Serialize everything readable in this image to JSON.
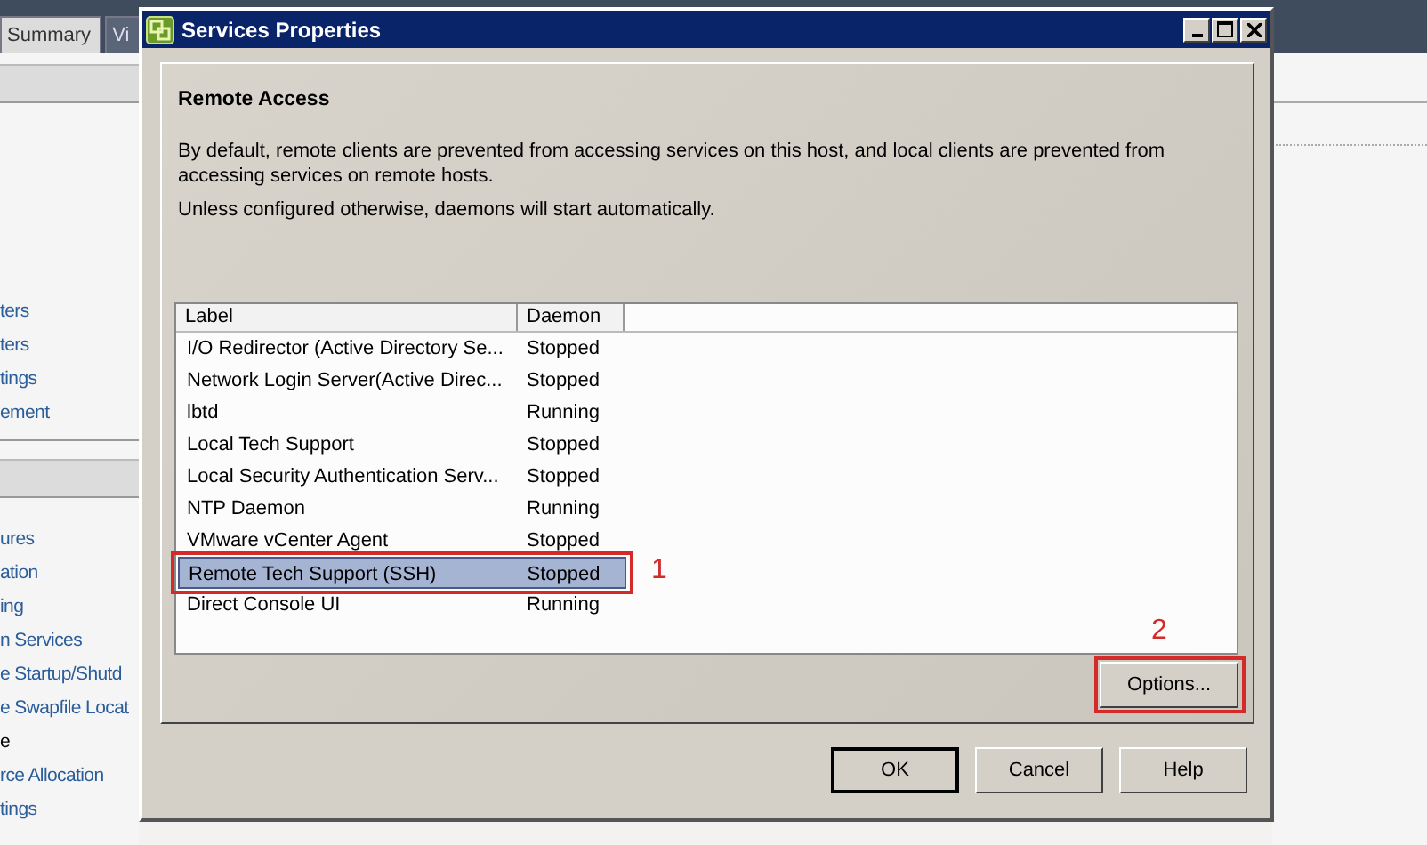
{
  "background_window": {
    "tabs": [
      {
        "label": "Summary",
        "selected": true
      },
      {
        "label": "Vi",
        "selected": false
      }
    ],
    "sidebar": {
      "groups": [
        {
          "items": [
            {
              "label": "ters",
              "selected": false
            },
            {
              "label": "ters",
              "selected": false
            },
            {
              "label": "tings",
              "selected": false
            },
            {
              "label": "ement",
              "selected": false
            }
          ]
        },
        {
          "items": [
            {
              "label": "ures",
              "selected": false
            },
            {
              "label": "ation",
              "selected": false
            },
            {
              "label": "ing",
              "selected": false
            },
            {
              "label": "n Services",
              "selected": false
            },
            {
              "label": "e Startup/Shutd",
              "selected": false
            },
            {
              "label": "e Swapfile Locat",
              "selected": false
            },
            {
              "label": "e",
              "selected": true
            },
            {
              "label": "rce Allocation",
              "selected": false
            },
            {
              "label": "tings",
              "selected": false
            }
          ]
        }
      ]
    }
  },
  "dialog": {
    "title": "Services Properties",
    "section": {
      "heading": "Remote Access",
      "paragraphs": [
        "By default, remote clients are prevented from accessing services on this host, and local clients are prevented from accessing services on remote hosts.",
        "Unless configured otherwise, daemons will start automatically."
      ]
    },
    "table": {
      "columns": [
        "Label",
        "Daemon"
      ],
      "rows": [
        {
          "label": "I/O Redirector (Active Directory Se...",
          "daemon": "Stopped",
          "selected": false
        },
        {
          "label": "Network Login Server(Active Direc...",
          "daemon": "Stopped",
          "selected": false
        },
        {
          "label": "lbtd",
          "daemon": "Running",
          "selected": false
        },
        {
          "label": "Local Tech Support",
          "daemon": "Stopped",
          "selected": false
        },
        {
          "label": "Local Security Authentication Serv...",
          "daemon": "Stopped",
          "selected": false
        },
        {
          "label": "NTP Daemon",
          "daemon": "Running",
          "selected": false
        },
        {
          "label": "VMware vCenter Agent",
          "daemon": "Stopped",
          "selected": false
        },
        {
          "label": "Remote Tech Support (SSH)",
          "daemon": "Stopped",
          "selected": true,
          "callout": "1"
        },
        {
          "label": "Direct Console UI",
          "daemon": "Running",
          "selected": false
        }
      ]
    },
    "options_button": {
      "label": "Options...",
      "callout": "2"
    },
    "buttons": [
      {
        "label": "OK",
        "default": true
      },
      {
        "label": "Cancel",
        "default": false
      },
      {
        "label": "Help",
        "default": false
      }
    ]
  }
}
